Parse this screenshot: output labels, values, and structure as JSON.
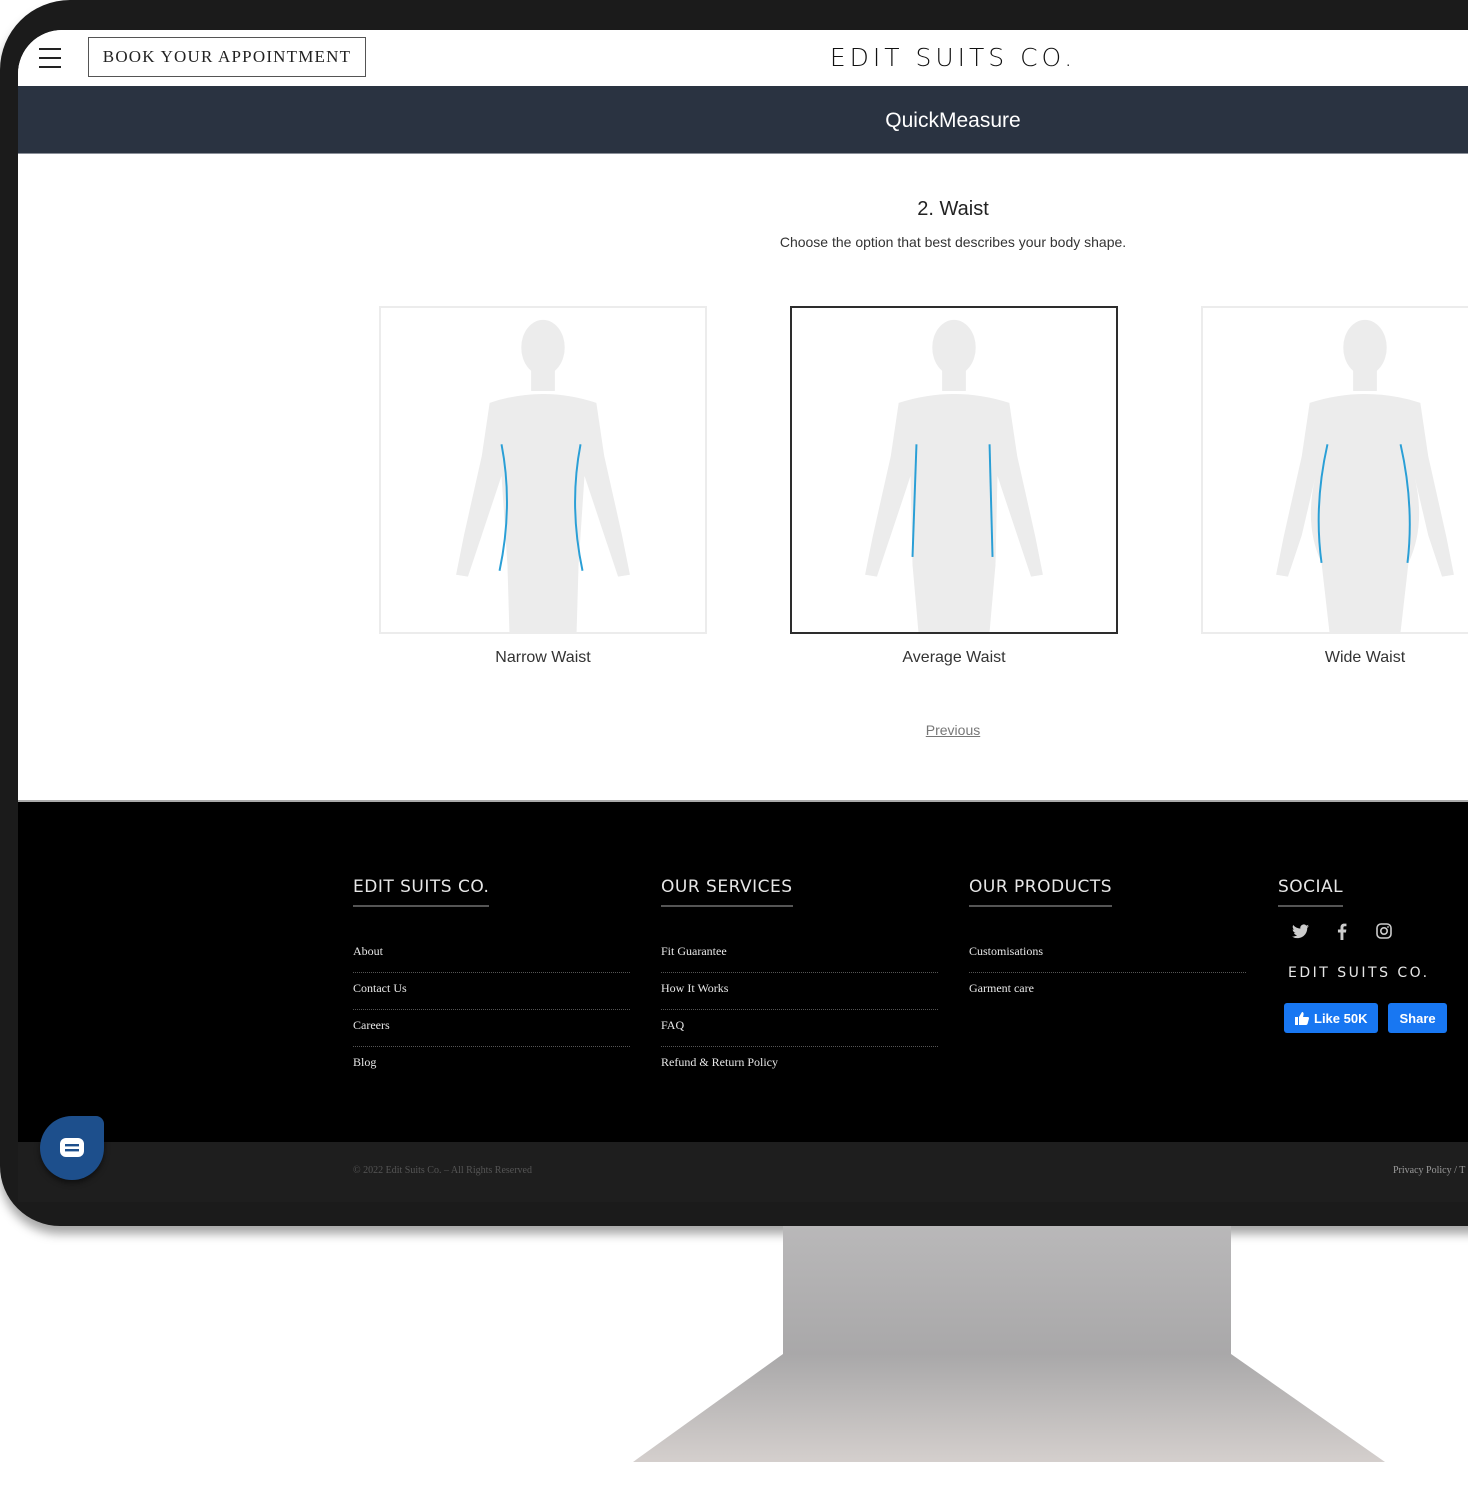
{
  "header": {
    "book_button": "BOOK YOUR APPOINTMENT",
    "logo": "EDIT SUITS CO."
  },
  "banner": {
    "title": "QuickMeasure"
  },
  "step": {
    "title": "2. Waist",
    "subtitle": "Choose the option that best describes your body shape.",
    "options": [
      {
        "label": "Narrow Waist",
        "selected": false
      },
      {
        "label": "Average Waist",
        "selected": true
      },
      {
        "label": "Wide Waist",
        "selected": false
      }
    ],
    "previous_link": "Previous"
  },
  "footer": {
    "columns": [
      {
        "heading": "EDIT SUITS CO.",
        "links": [
          "About",
          "Contact Us",
          "Careers",
          "Blog"
        ]
      },
      {
        "heading": "OUR SERVICES",
        "links": [
          "Fit Guarantee",
          "How It Works",
          "FAQ",
          "Refund & Return Policy"
        ]
      },
      {
        "heading": "OUR PRODUCTS",
        "links": [
          "Customisations",
          "Garment care"
        ]
      }
    ],
    "social": {
      "heading": "SOCIAL",
      "icons": [
        "twitter-icon",
        "facebook-icon",
        "instagram-icon"
      ],
      "brand": "EDIT SUITS CO.",
      "like_label": "Like 50K",
      "share_label": "Share",
      "fb_color": "#1877f2"
    },
    "copyright": "© 2022 Edit Suits Co. – All Rights Reserved",
    "privacy": "Privacy Policy / T"
  },
  "colors": {
    "banner_bg": "#2a3341",
    "measure_line": "#2a9fd6",
    "chat_button": "#1d4f8c"
  }
}
